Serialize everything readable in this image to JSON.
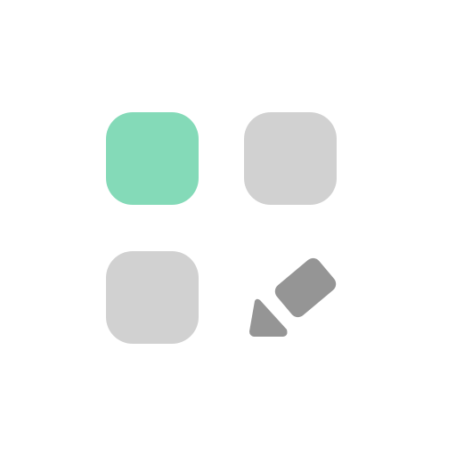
{
  "icon": {
    "name": "apps-edit-icon",
    "tiles": [
      {
        "name": "app-tile-icon",
        "color": "#84dab8",
        "state": "selected"
      },
      {
        "name": "app-tile-icon",
        "color": "#d1d1d1",
        "state": "default"
      },
      {
        "name": "app-tile-icon",
        "color": "#d1d1d1",
        "state": "default"
      }
    ],
    "edit": {
      "name": "pencil-icon",
      "color": "#959595"
    }
  }
}
